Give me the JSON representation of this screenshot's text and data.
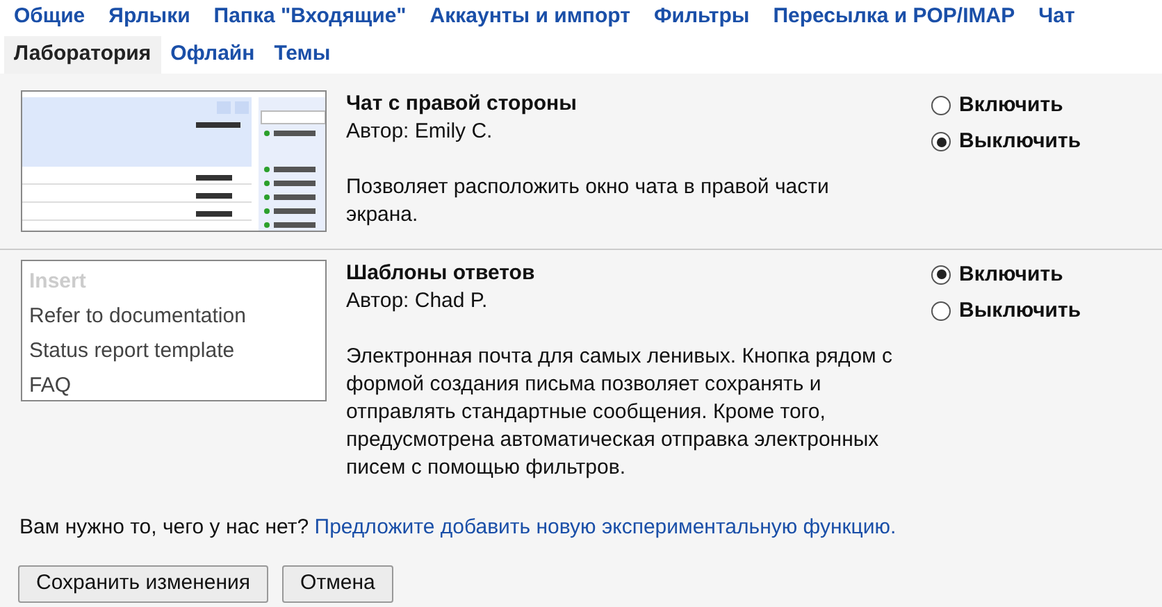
{
  "tabs_row_1": [
    {
      "label": "Общие",
      "selected": false
    },
    {
      "label": "Ярлыки",
      "selected": false
    },
    {
      "label": "Папка \"Входящие\"",
      "selected": false
    },
    {
      "label": "Аккаунты и импорт",
      "selected": false
    },
    {
      "label": "Фильтры",
      "selected": false
    },
    {
      "label": "Пересылка и POP/IMAP",
      "selected": false
    },
    {
      "label": "Чат",
      "selected": false
    }
  ],
  "tabs_row_2": [
    {
      "label": "Лаборатория",
      "selected": true
    },
    {
      "label": "Офлайн",
      "selected": false
    },
    {
      "label": "Темы",
      "selected": false
    }
  ],
  "labs": [
    {
      "preview": {
        "kind": "chat"
      },
      "title": "Чат с правой стороны",
      "author": "Автор: Emily C.",
      "description": "Позволяет расположить окно чата в правой части экрана.",
      "options": [
        {
          "label": "Включить",
          "selected": false
        },
        {
          "label": "Выключить",
          "selected": true
        }
      ]
    },
    {
      "preview": {
        "kind": "list",
        "items": [
          {
            "label": "Insert",
            "disabled": true
          },
          {
            "label": "Refer to documentation",
            "disabled": false
          },
          {
            "label": "Status report template",
            "disabled": false
          },
          {
            "label": "FAQ",
            "disabled": false
          }
        ]
      },
      "title": "Шаблоны ответов",
      "author": "Автор: Chad P.",
      "description": "Электронная почта для самых ленивых. Кнопка рядом с формой создания письма позволяет сохранять и отправлять стандартные сообщения. Кроме того, предусмотрена автоматическая отправка электронных писем с помощью фильтров.",
      "options": [
        {
          "label": "Включить",
          "selected": true
        },
        {
          "label": "Выключить",
          "selected": false
        }
      ]
    }
  ],
  "footer": {
    "text": "Вам нужно то, чего у нас нет?",
    "link": "Предложите добавить новую экспериментальную функцию."
  },
  "buttons": [
    "Сохранить изменения",
    "Отмена"
  ]
}
